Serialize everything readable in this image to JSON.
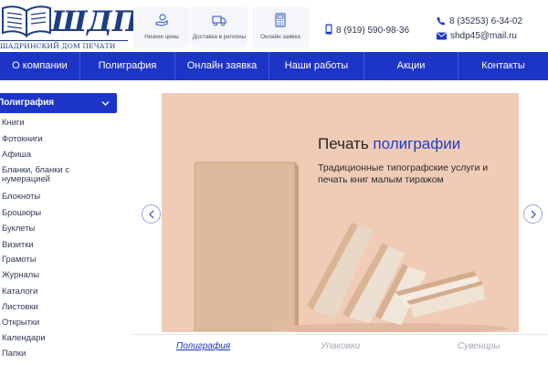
{
  "logo": {
    "letters": "ШДП",
    "tagline": "ШАДРИНСКИЙ ДОМ ПЕЧАТИ"
  },
  "features": [
    {
      "icon": "hand-coin-icon",
      "label": "Низкие цены"
    },
    {
      "icon": "truck-icon",
      "label": "Доставка в регионы"
    },
    {
      "icon": "calculator-icon",
      "label": "Онлайн заявка"
    }
  ],
  "contacts": {
    "mobile": "8 (919) 590-98-36",
    "phone": "8 (35253) 6-34-02",
    "email": "shdp45@mail.ru"
  },
  "nav": [
    "О компании",
    "Полиграфия",
    "Онлайн заявка",
    "Наши работы",
    "Акции",
    "Контакты"
  ],
  "sidebar": {
    "header": "Полиграфия",
    "items": [
      "Книги",
      "Фотокниги",
      "Афиша",
      "Бланки, бланки с нумерацией",
      "Блокноты",
      "Брошюры",
      "Буклеты",
      "Визитки",
      "Грамоты",
      "Журналы",
      "Каталоги",
      "Листовки",
      "Открытки",
      "Календари",
      "Папки"
    ]
  },
  "banner": {
    "title_plain": "Печать ",
    "title_highlight": "полиграфии",
    "subtitle": "Традиционные типографские услуги и печать книг малым тиражом"
  },
  "tabs": [
    {
      "label": "Полиграфия",
      "active": true
    },
    {
      "label": "Упаковки",
      "active": false
    },
    {
      "label": "Сувениры",
      "active": false
    }
  ],
  "colors": {
    "primary": "#1d35c6",
    "logo": "#1d3d86",
    "banner_bg": "#f0ccb7",
    "highlight": "#1e3fc7"
  }
}
